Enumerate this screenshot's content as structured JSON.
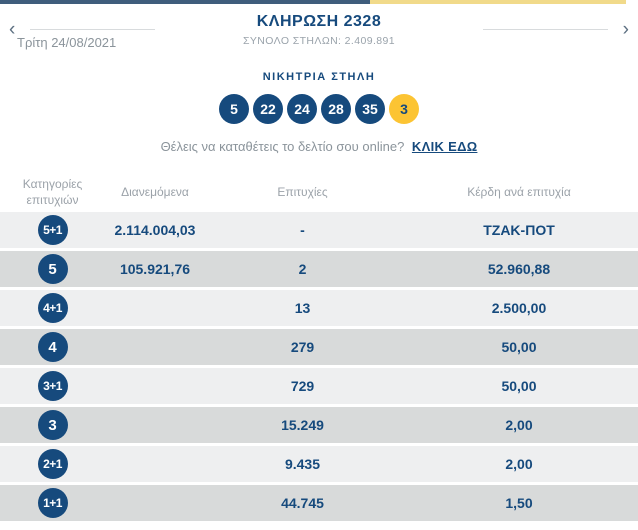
{
  "header": {
    "title": "ΚΛΗΡΩΣΗ 2328",
    "subtitle": "ΣΥΝΟΛΟ ΣΤΗΛΩΝ: 2.409.891",
    "date": "Τρίτη 24/08/2021",
    "prev_icon": "‹",
    "next_icon": "›"
  },
  "winning": {
    "label": "ΝΙΚΗΤΡΙΑ ΣΤΗΛΗ",
    "numbers": [
      "5",
      "22",
      "24",
      "28",
      "35"
    ],
    "joker": "3"
  },
  "online": {
    "text": "Θέλεις να καταθέτεις το δελτίο σου online?",
    "link": "ΚΛΙΚ ΕΔΩ"
  },
  "table": {
    "header": {
      "category_line1": "Κατηγορίες",
      "category_line2": "επιτυχιών",
      "distributed": "Διανεμόμενα",
      "winners": "Επιτυχίες",
      "prize": "Κέρδη ανά επιτυχία"
    },
    "rows": [
      {
        "category": "5+1",
        "distributed": "2.114.004,03",
        "winners": "-",
        "prize": "ΤΖΑΚ-ΠΟΤ"
      },
      {
        "category": "5",
        "distributed": "105.921,76",
        "winners": "2",
        "prize": "52.960,88"
      },
      {
        "category": "4+1",
        "distributed": "",
        "winners": "13",
        "prize": "2.500,00"
      },
      {
        "category": "4",
        "distributed": "",
        "winners": "279",
        "prize": "50,00"
      },
      {
        "category": "3+1",
        "distributed": "",
        "winners": "729",
        "prize": "50,00"
      },
      {
        "category": "3",
        "distributed": "",
        "winners": "15.249",
        "prize": "2,00"
      },
      {
        "category": "2+1",
        "distributed": "",
        "winners": "9.435",
        "prize": "2,00"
      },
      {
        "category": "1+1",
        "distributed": "",
        "winners": "44.745",
        "prize": "1,50"
      }
    ]
  },
  "colors": {
    "navy": "#164a7d",
    "joker_yellow": "#fcc433",
    "top_bar_navy": "#3f5d7c",
    "top_bar_yellow": "#f1da8a",
    "row_light": "#eeeff0",
    "row_dark": "#d8dada"
  }
}
